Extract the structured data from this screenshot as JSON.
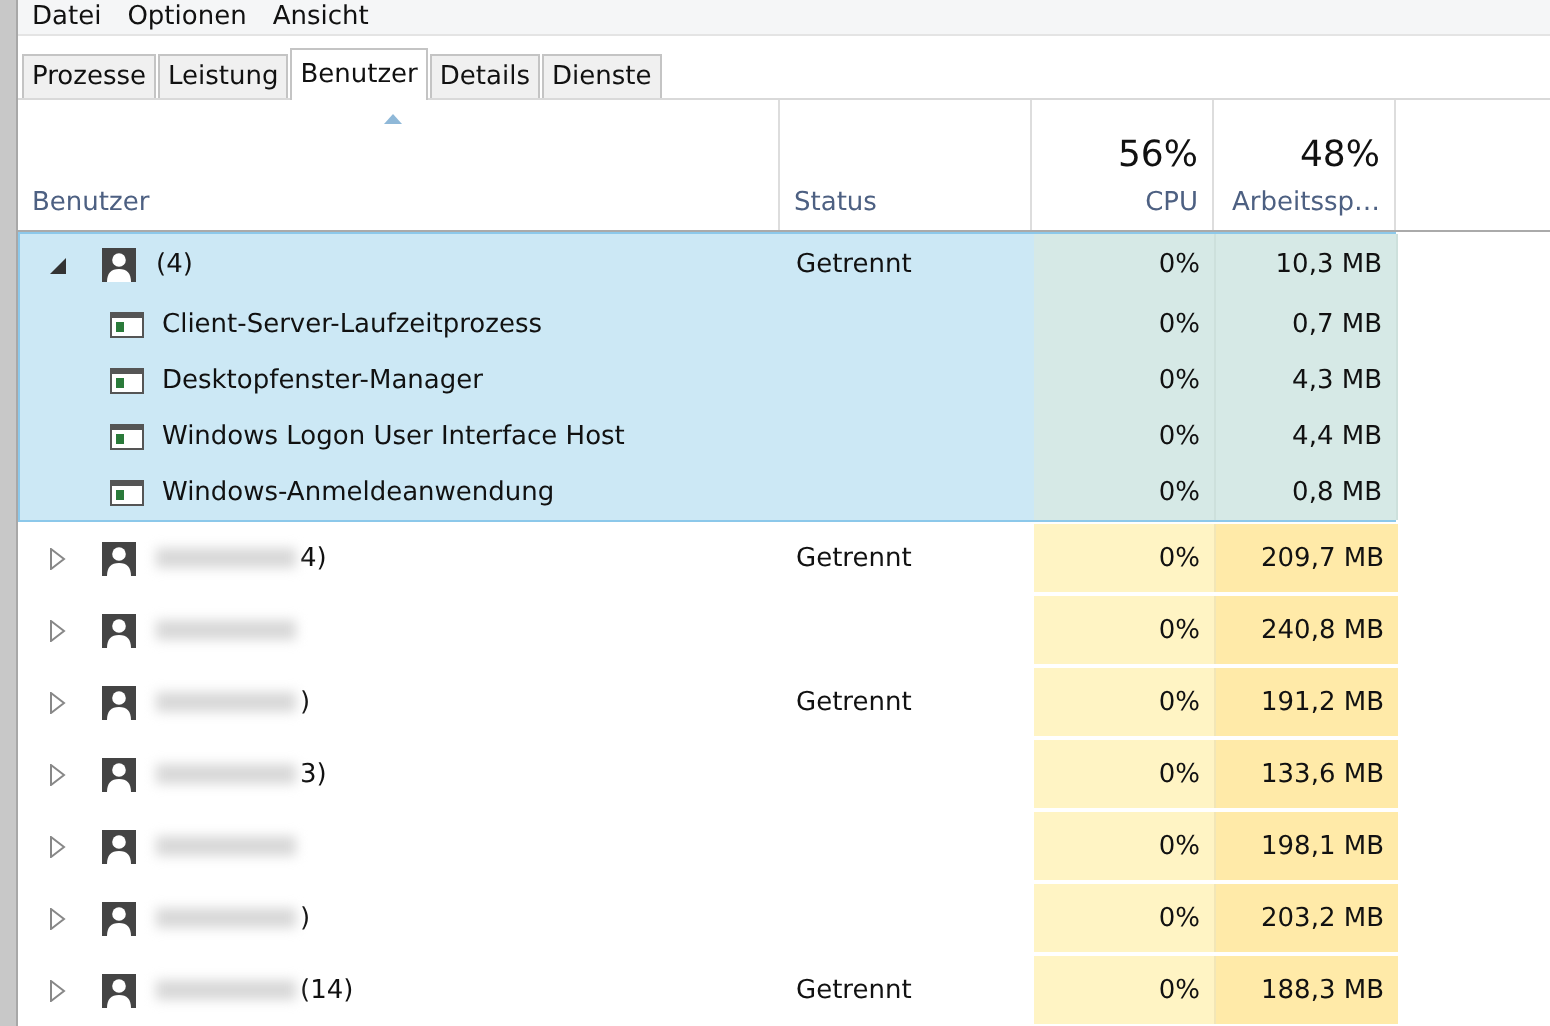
{
  "menu": [
    "Datei",
    "Optionen",
    "Ansicht"
  ],
  "tabs": [
    {
      "label": "Prozesse",
      "selected": false
    },
    {
      "label": "Leistung",
      "selected": false
    },
    {
      "label": "Benutzer",
      "selected": true
    },
    {
      "label": "Details",
      "selected": false
    },
    {
      "label": "Dienste",
      "selected": false
    }
  ],
  "columns": [
    {
      "label": "Benutzer"
    },
    {
      "label": "Status"
    },
    {
      "total": "56%",
      "label": "CPU"
    },
    {
      "total": "48%",
      "label": "Arbeitssp…"
    }
  ],
  "users": [
    {
      "name": "(4)",
      "redacted": false,
      "expanded": true,
      "selected": true,
      "status": "Getrennt",
      "cpu": "0%",
      "memory": "10,3 MB",
      "children": [
        {
          "name": "Client-Server-Laufzeitprozess",
          "cpu": "0%",
          "memory": "0,7 MB"
        },
        {
          "name": "Desktopfenster-Manager",
          "cpu": "0%",
          "memory": "4,3 MB"
        },
        {
          "name": "Windows Logon User Interface Host",
          "cpu": "0%",
          "memory": "4,4 MB"
        },
        {
          "name": "Windows-Anmeldeanwendung",
          "cpu": "0%",
          "memory": "0,8 MB"
        }
      ]
    },
    {
      "name": "4)",
      "redacted": true,
      "expanded": false,
      "selected": false,
      "status": "Getrennt",
      "cpu": "0%",
      "memory": "209,7 MB"
    },
    {
      "redacted": true,
      "expanded": false,
      "selected": false,
      "cpu": "0%",
      "memory": "240,8 MB"
    },
    {
      "name": ")",
      "redacted": true,
      "expanded": false,
      "selected": false,
      "status": "Getrennt",
      "cpu": "0%",
      "memory": "191,2 MB"
    },
    {
      "name": "3)",
      "redacted": true,
      "expanded": false,
      "selected": false,
      "cpu": "0%",
      "memory": "133,6 MB"
    },
    {
      "redacted": true,
      "expanded": false,
      "selected": false,
      "cpu": "0%",
      "memory": "198,1 MB"
    },
    {
      "name": ")",
      "redacted": true,
      "expanded": false,
      "selected": false,
      "cpu": "0%",
      "memory": "203,2 MB"
    },
    {
      "name": "(14)",
      "redacted": true,
      "expanded": false,
      "selected": false,
      "status": "Getrennt",
      "cpu": "0%",
      "memory": "188,3 MB"
    }
  ]
}
